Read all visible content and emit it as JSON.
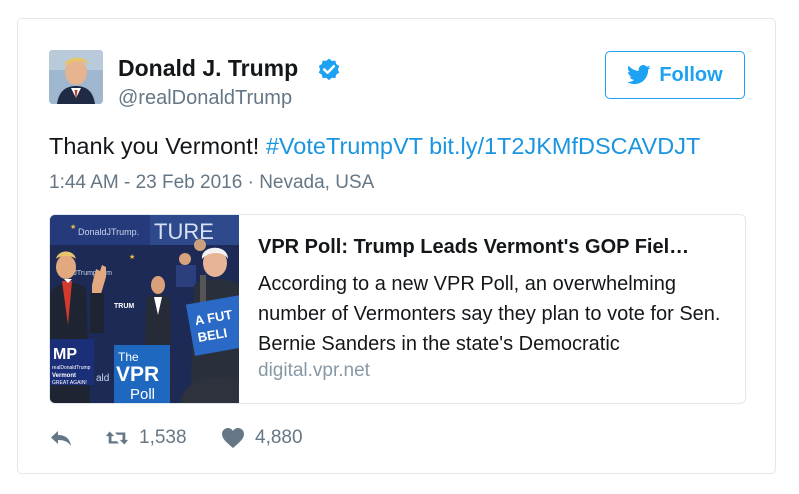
{
  "author": {
    "name": "Donald J. Trump",
    "handle": "@realDonaldTrump",
    "avatar_icon": "profile-photo"
  },
  "follow_button": {
    "label": "Follow",
    "icon": "twitter-bird-icon"
  },
  "tweet": {
    "text_prefix": "Thank you Vermont! ",
    "hashtag": "#VoteTrumpVT",
    "link": "bit.ly/1T2JKMfDSCAVDJT",
    "timestamp": "1:44 AM - 23 Feb 2016",
    "separator": " · ",
    "location": "Nevada, USA"
  },
  "card": {
    "title": "VPR Poll: Trump Leads Vermont's GOP Fiel…",
    "description": "According to a new VPR Poll, an overwhelming number of Vermonters say they plan to vote for Sen. Bernie Sanders in the state's Democratic",
    "domain": "digital.vpr.net",
    "image": {
      "banner_text": "DonaldJTrump.",
      "site_text": "aldJTrump.com",
      "stage_text": "TRUM",
      "ture_text": "TURE",
      "sign_line1": "A FUT",
      "sign_line2": "BELI",
      "mp_text": "MP",
      "vermont_text": "Vermont",
      "sub_text": "realDonaldTrump",
      "great_text": "GREAT AGAIN!",
      "ald_text": "ald",
      "poll_the": "The",
      "poll_vpr": "VPR",
      "poll_word": "Poll"
    }
  },
  "actions": {
    "retweet_count": "1,538",
    "like_count": "4,880"
  },
  "colors": {
    "accent": "#1da1f2",
    "link": "#1b95e0",
    "muted": "#657786"
  }
}
